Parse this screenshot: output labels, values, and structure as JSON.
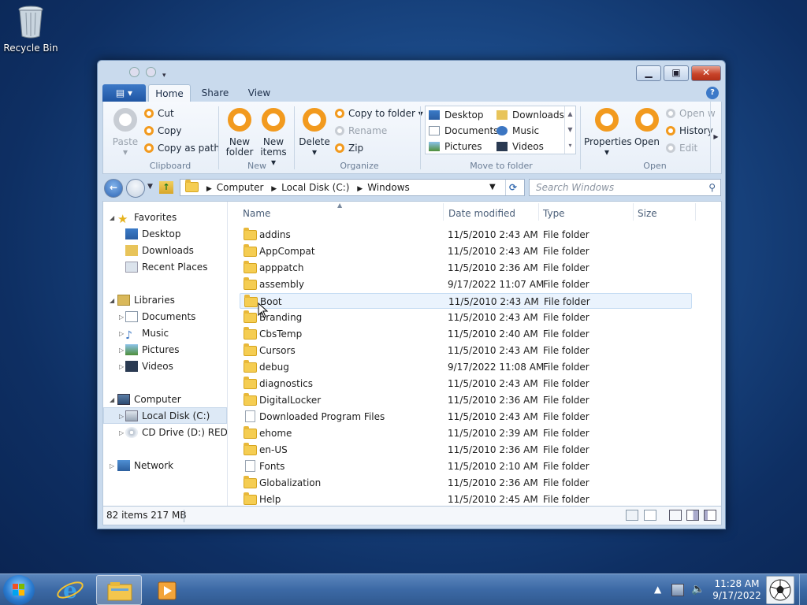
{
  "desktop": {
    "recycle_bin_label": "Recycle Bin"
  },
  "window": {
    "ribbon_tabs": [
      "Home",
      "Share",
      "View"
    ],
    "clipboard": {
      "paste": "Paste",
      "cut": "Cut",
      "copy": "Copy",
      "copy_as_path": "Copy as path",
      "group": "Clipboard"
    },
    "new": {
      "new_folder_1": "New",
      "new_folder_2": "folder",
      "new_items_1": "New",
      "new_items_2": "items ▾",
      "group": "New"
    },
    "organize": {
      "delete": "Delete",
      "copy_to_folder": "Copy to folder ▾",
      "rename": "Rename",
      "zip": "Zip",
      "group": "Organize"
    },
    "move_to": {
      "items": [
        "Desktop",
        "Downloads",
        "Documents",
        "Music",
        "Pictures",
        "Videos"
      ],
      "group": "Move to folder"
    },
    "open": {
      "properties": "Properties",
      "open": "Open",
      "open_with": "Open w",
      "history": "History",
      "edit": "Edit",
      "group": "Open"
    },
    "address": {
      "crumbs": [
        "Computer",
        "Local Disk (C:)",
        "Windows"
      ],
      "search_placeholder": "Search Windows"
    },
    "nav": {
      "favorites": "Favorites",
      "fav_items": [
        "Desktop",
        "Downloads",
        "Recent Places"
      ],
      "libraries": "Libraries",
      "lib_items": [
        "Documents",
        "Music",
        "Pictures",
        "Videos"
      ],
      "computer": "Computer",
      "comp_items": [
        "Local Disk (C:)",
        "CD Drive (D:) REDPIL"
      ],
      "network": "Network"
    },
    "columns": [
      "Name",
      "Date modified",
      "Type",
      "Size"
    ],
    "files": [
      {
        "name": "addins",
        "date": "11/5/2010 2:43 AM",
        "type": "File folder",
        "icon": "folder"
      },
      {
        "name": "AppCompat",
        "date": "11/5/2010 2:43 AM",
        "type": "File folder",
        "icon": "folder"
      },
      {
        "name": "apppatch",
        "date": "11/5/2010 2:36 AM",
        "type": "File folder",
        "icon": "folder"
      },
      {
        "name": "assembly",
        "date": "9/17/2022 11:07 AM",
        "type": "File folder",
        "icon": "folder"
      },
      {
        "name": "Boot",
        "date": "11/5/2010 2:43 AM",
        "type": "File folder",
        "icon": "folder"
      },
      {
        "name": "Branding",
        "date": "11/5/2010 2:43 AM",
        "type": "File folder",
        "icon": "folder"
      },
      {
        "name": "CbsTemp",
        "date": "11/5/2010 2:40 AM",
        "type": "File folder",
        "icon": "folder"
      },
      {
        "name": "Cursors",
        "date": "11/5/2010 2:43 AM",
        "type": "File folder",
        "icon": "folder"
      },
      {
        "name": "debug",
        "date": "9/17/2022 11:08 AM",
        "type": "File folder",
        "icon": "folder"
      },
      {
        "name": "diagnostics",
        "date": "11/5/2010 2:43 AM",
        "type": "File folder",
        "icon": "folder"
      },
      {
        "name": "DigitalLocker",
        "date": "11/5/2010 2:36 AM",
        "type": "File folder",
        "icon": "folder"
      },
      {
        "name": "Downloaded Program Files",
        "date": "11/5/2010 2:43 AM",
        "type": "File folder",
        "icon": "doc"
      },
      {
        "name": "ehome",
        "date": "11/5/2010 2:39 AM",
        "type": "File folder",
        "icon": "folder"
      },
      {
        "name": "en-US",
        "date": "11/5/2010 2:36 AM",
        "type": "File folder",
        "icon": "folder"
      },
      {
        "name": "Fonts",
        "date": "11/5/2010 2:10 AM",
        "type": "File folder",
        "icon": "doc"
      },
      {
        "name": "Globalization",
        "date": "11/5/2010 2:36 AM",
        "type": "File folder",
        "icon": "folder"
      },
      {
        "name": "Help",
        "date": "11/5/2010 2:45 AM",
        "type": "File folder",
        "icon": "folder"
      }
    ],
    "selected_file": "Boot",
    "status": "82 items  217 MB"
  },
  "taskbar": {
    "time": "11:28 AM",
    "date": "9/17/2022"
  }
}
